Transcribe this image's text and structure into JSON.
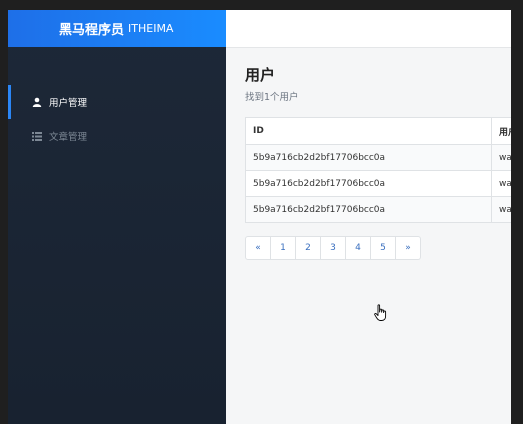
{
  "brand": {
    "name": "黑马程序员",
    "sub": "ITHEIMA"
  },
  "sidebar": {
    "items": [
      {
        "label": "用户管理",
        "icon": "user-icon",
        "active": true
      },
      {
        "label": "文章管理",
        "icon": "list-icon",
        "active": false
      }
    ]
  },
  "main": {
    "title": "用户",
    "subtitle": "找到1个用户",
    "table": {
      "headers": [
        "ID",
        "用户"
      ],
      "rows": [
        [
          "5b9a716cb2d2bf17706bcc0a",
          "wa"
        ],
        [
          "5b9a716cb2d2bf17706bcc0a",
          "wa"
        ],
        [
          "5b9a716cb2d2bf17706bcc0a",
          "wa"
        ]
      ]
    },
    "pagination": [
      "«",
      "1",
      "2",
      "3",
      "4",
      "5",
      "»"
    ]
  },
  "colors": {
    "accent": "#2b86f5",
    "sidebar_bg": "#1d2838",
    "brand_bg": "#1e6fe8"
  }
}
